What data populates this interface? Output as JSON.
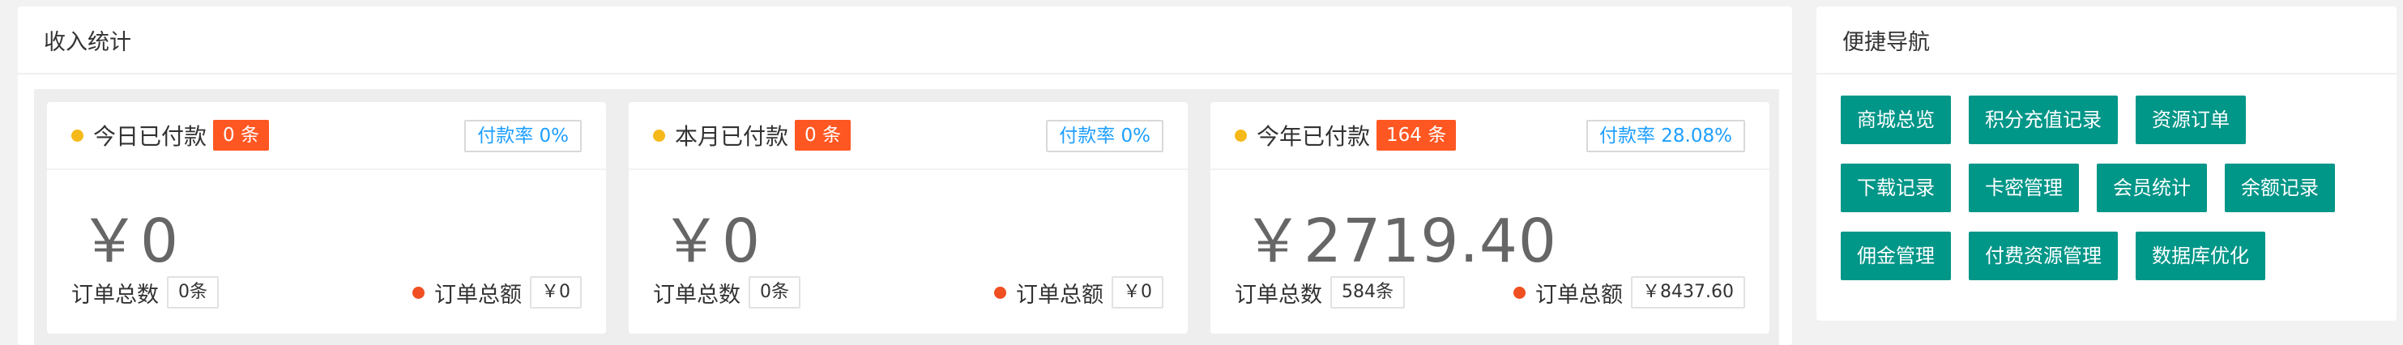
{
  "income": {
    "title": "收入统计",
    "cards": [
      {
        "title": "今日已付款",
        "count": "0 条",
        "rate": "付款率 0%",
        "amount": "￥0",
        "orders_label": "订单总数",
        "orders_value": "0条",
        "total_label": "订单总额",
        "total_value": "￥0"
      },
      {
        "title": "本月已付款",
        "count": "0 条",
        "rate": "付款率 0%",
        "amount": "￥0",
        "orders_label": "订单总数",
        "orders_value": "0条",
        "total_label": "订单总额",
        "total_value": "￥0"
      },
      {
        "title": "今年已付款",
        "count": "164 条",
        "rate": "付款率 28.08%",
        "amount": "￥2719.40",
        "orders_label": "订单总数",
        "orders_value": "584条",
        "total_label": "订单总额",
        "total_value": "￥8437.60"
      }
    ]
  },
  "nav": {
    "title": "便捷导航",
    "rows": [
      [
        "商城总览",
        "积分充值记录",
        "资源订单"
      ],
      [
        "下载记录",
        "卡密管理",
        "会员统计",
        "余额记录"
      ],
      [
        "佣金管理",
        "付费资源管理",
        "数据库优化"
      ]
    ]
  },
  "colors": {
    "accent": "#009688",
    "badge": "#ff5722",
    "rate_text": "#1e9fff",
    "dot_yellow": "#f5b919",
    "dot_red": "#f04f22"
  }
}
